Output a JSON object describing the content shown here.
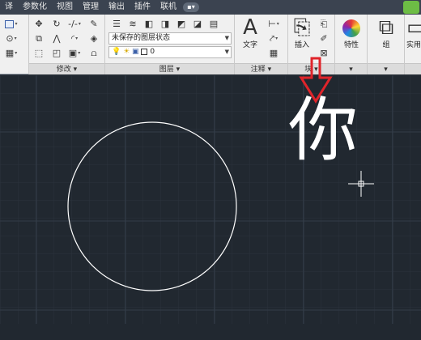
{
  "menu": {
    "items": [
      "译",
      "参数化",
      "视图",
      "管理",
      "输出",
      "插件",
      "联机"
    ],
    "toggle_glyph": "▪▾"
  },
  "ribbon": {
    "modify_panel": {
      "title": "修改 ▾"
    },
    "layers_panel": {
      "title": "图层 ▾",
      "layer_state_value": "未保存的图层状态",
      "current_layer_value": "0"
    },
    "annotation_panel": {
      "title": "注释 ▾",
      "text_label": "文字"
    },
    "block_panel": {
      "title": "块 ▾",
      "insert_label": "插入"
    },
    "properties_panel": {
      "label": "特性",
      "title": "▾"
    },
    "groups_panel": {
      "label": "组",
      "title": "▾"
    },
    "utilities_panel": {
      "label": "实用"
    }
  },
  "drawing": {
    "text_object": "你",
    "background_color": "#212830",
    "circle_color": "#ffffff",
    "annotation_arrow_color": "#e0242a"
  }
}
